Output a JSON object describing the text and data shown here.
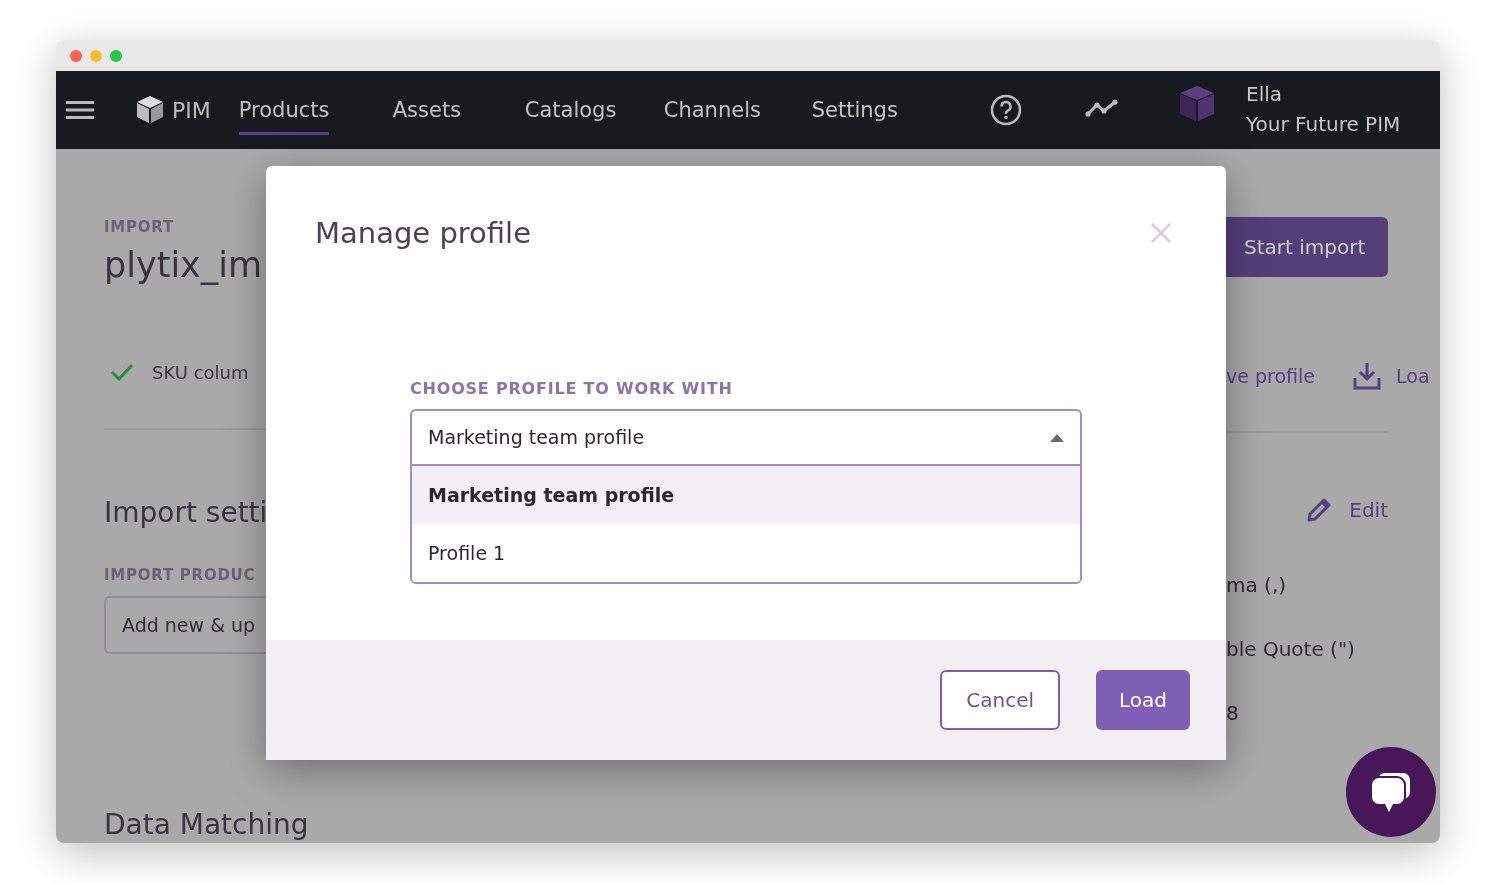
{
  "nav": {
    "brand": "PIM",
    "items": [
      {
        "label": "Products",
        "selected": true
      },
      {
        "label": "Assets",
        "selected": false
      },
      {
        "label": "Catalogs",
        "selected": false
      },
      {
        "label": "Channels",
        "selected": false
      },
      {
        "label": "Settings",
        "selected": false
      }
    ],
    "user": {
      "name": "Ella",
      "company": "Your Future PIM"
    }
  },
  "page": {
    "eyebrow": "IMPORT",
    "title": "plytix_im",
    "check_text": "SKU colum",
    "section_title": "Import setti",
    "field_label": "IMPORT PRODUC",
    "field_value": "Add new & up",
    "bottom_title": "Data Matching",
    "start_button": "Start import",
    "save_link": "ve profile",
    "load_link": "Loa",
    "edit_link": "Edit",
    "settings": [
      "ma (,)",
      "ble Quote (\")",
      "8"
    ]
  },
  "modal": {
    "title": "Manage profile",
    "label": "CHOOSE PROFILE TO WORK WITH",
    "dropdown": {
      "value": "Marketing team profile",
      "expanded": true,
      "options": [
        {
          "label": "Marketing team profile",
          "selected": true
        },
        {
          "label": "Profile 1",
          "selected": false
        }
      ]
    },
    "buttons": [
      {
        "label": "Cancel",
        "kind": "secondary"
      },
      {
        "label": "Load",
        "kind": "primary"
      }
    ]
  }
}
